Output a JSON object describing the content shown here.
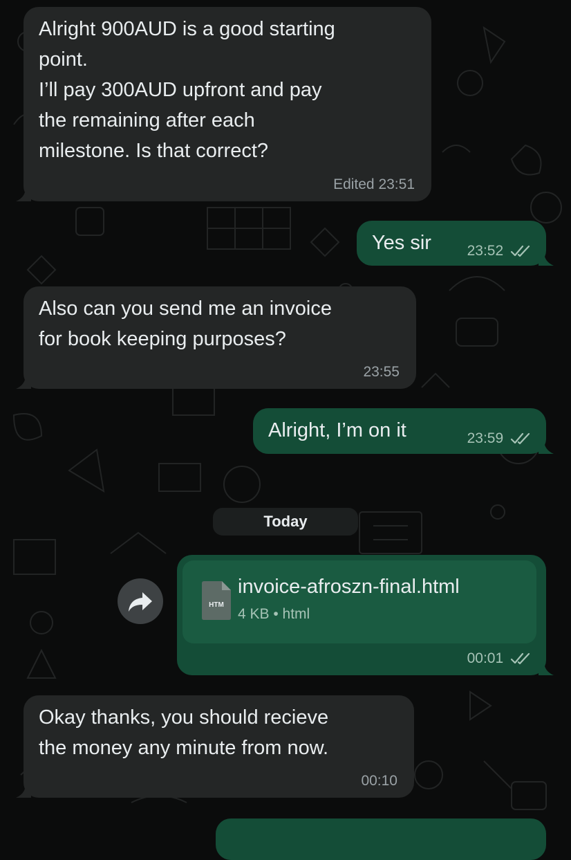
{
  "messages": [
    {
      "direction": "incoming",
      "lines": [
        "Alright 900AUD is a good starting",
        "point.",
        "I’ll pay 300AUD upfront and pay",
        "the remaining after each",
        "milestone. Is that correct?"
      ],
      "meta": "Edited 23:51"
    },
    {
      "direction": "outgoing",
      "lines": [
        "Yes sir"
      ],
      "meta": "23:52",
      "status": "read-double-check-icon"
    },
    {
      "direction": "incoming",
      "lines": [
        "Also can you send me an invoice",
        "for book keeping purposes?"
      ],
      "meta": "23:55"
    },
    {
      "direction": "outgoing",
      "lines": [
        "Alright, I’m on it"
      ],
      "meta": "23:59",
      "status": "read-double-check-icon"
    },
    {
      "direction": "outgoing",
      "type": "file",
      "file_icon_label": "HTM",
      "file_name": "invoice-afroszn-final.html",
      "file_meta": "4 KB • html",
      "meta": "00:01",
      "status": "read-double-check-icon"
    },
    {
      "direction": "incoming",
      "lines": [
        "Okay thanks, you should recieve",
        "the money any minute from now."
      ],
      "meta": "00:10"
    }
  ],
  "day_divider": "Today",
  "icons": {
    "forward": "forward-arrow-icon",
    "file": "document-icon",
    "read_receipt": "double-check-icon"
  },
  "colors": {
    "background": "#0b0c0c",
    "incoming_bubble": "#242626",
    "outgoing_bubble": "#144d37",
    "read_tick": "#a6c3b6"
  }
}
